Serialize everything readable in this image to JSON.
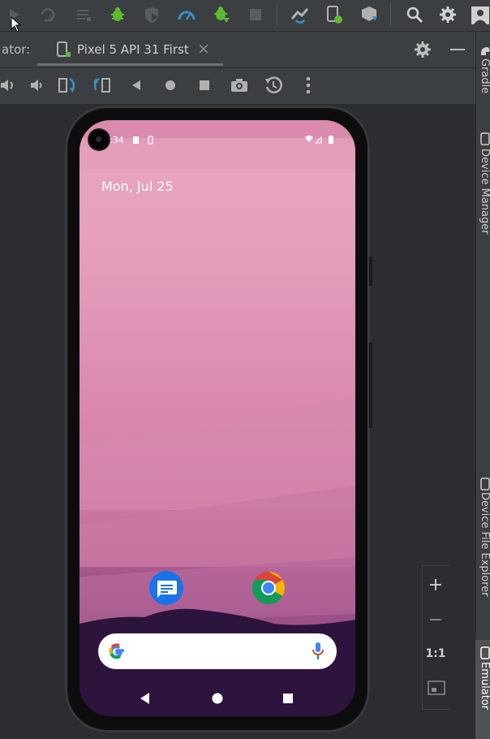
{
  "toolbar": {
    "icons": [
      "run-icon",
      "apply-changes-icon",
      "build-icon",
      "debug-icon",
      "coverage-icon",
      "profiler-icon",
      "attach-debugger-icon",
      "stop-icon",
      "sync-gradle-icon",
      "device-manager-icon",
      "sdk-manager-icon",
      "search-icon",
      "settings-icon",
      "avatar-icon"
    ]
  },
  "emulator_panel": {
    "label": "ator:",
    "tab_title": "Pixel 5 API 31 First",
    "tab_close": "×"
  },
  "emulator_controls": [
    "power-icon",
    "volume-up-icon",
    "volume-down-icon",
    "rotate-left-icon",
    "rotate-right-icon",
    "back-icon",
    "home-icon",
    "overview-icon",
    "screenshot-icon",
    "snapshot-icon",
    "more-icon"
  ],
  "phone": {
    "status_time": ":34",
    "date": "Mon, Jul 25",
    "apps": [
      "Messages",
      "Chrome"
    ]
  },
  "zoom": {
    "zoom_in": "+",
    "zoom_out": "−",
    "actual_size": "1:1"
  },
  "right_tools": {
    "gradle": "Gradle",
    "device_manager": "Device Manager",
    "device_file_explorer": "Device File Explorer",
    "emulator": "Emulator"
  },
  "colors": {
    "toolbar_bg": "#3c3f41",
    "canvas_bg": "#2b2d30",
    "debug_green": "#5fb832",
    "accent_blue": "#3592c4"
  }
}
